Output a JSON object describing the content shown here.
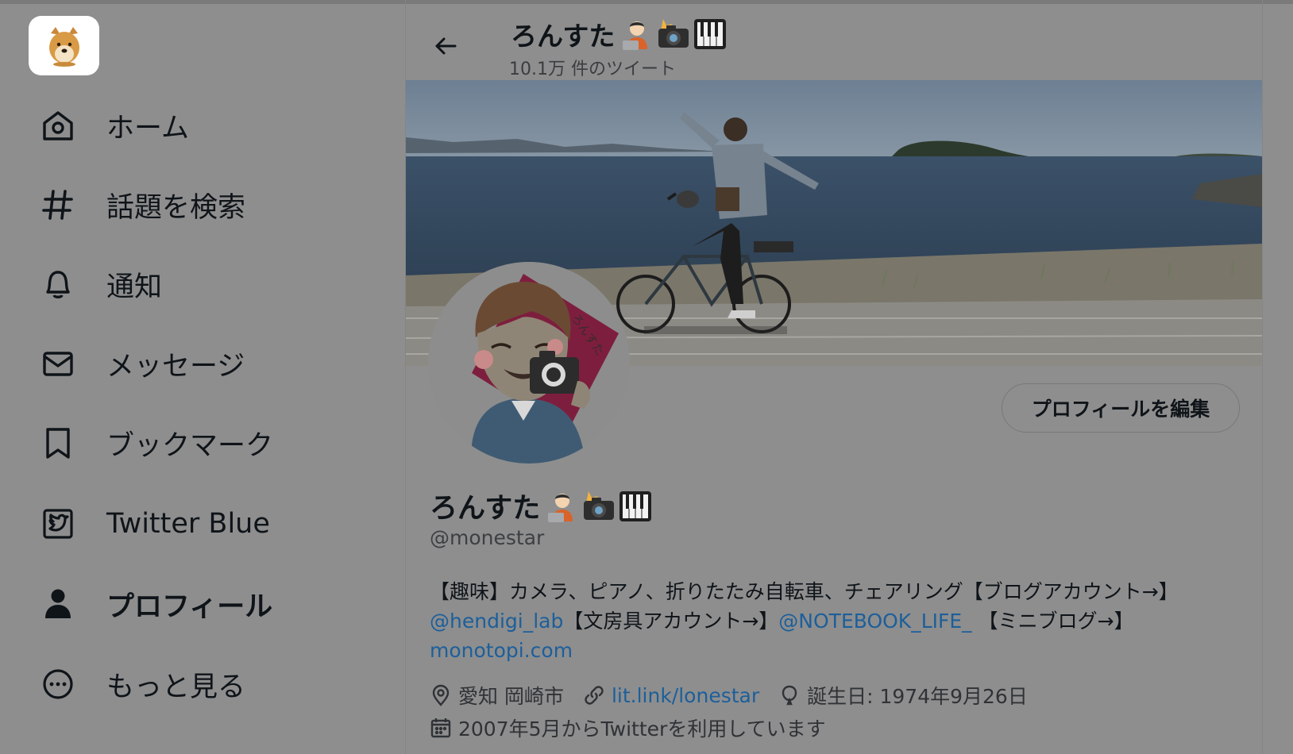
{
  "sidebar": {
    "items": [
      {
        "label": "ホーム",
        "icon": "home-icon"
      },
      {
        "label": "話題を検索",
        "icon": "hashtag-icon"
      },
      {
        "label": "通知",
        "icon": "bell-icon"
      },
      {
        "label": "メッセージ",
        "icon": "envelope-icon"
      },
      {
        "label": "ブックマーク",
        "icon": "bookmark-icon"
      },
      {
        "label": "Twitter Blue",
        "icon": "twitter-blue-icon"
      },
      {
        "label": "プロフィール",
        "icon": "person-icon",
        "active": true
      },
      {
        "label": "もっと見る",
        "icon": "more-circle-icon"
      }
    ]
  },
  "header": {
    "title": "ろんすた",
    "tweet_count": "10.1万 件のツイート"
  },
  "profile": {
    "name": "ろんすた",
    "handle": "@monestar",
    "edit_button": "プロフィールを編集",
    "bio": {
      "t1": "【趣味】カメラ、ピアノ、折りたたみ自転車、チェアリング【ブログアカウント→】",
      "link1": "@hendigi_lab",
      "t2": "【文房具アカウント→】",
      "link2": "@NOTEBOOK_LIFE_",
      "t3": " 【ミニブログ→】",
      "link3": "monotopi.com"
    },
    "location": "愛知 岡崎市",
    "website": "lit.link/lonestar",
    "birthday": "誕生日: 1974年9月26日",
    "joined": "2007年5月からTwitterを利用しています"
  },
  "colors": {
    "overlay_bg": "#8e8e8e",
    "link": "#1c5f9b",
    "text": "#0f1419"
  }
}
